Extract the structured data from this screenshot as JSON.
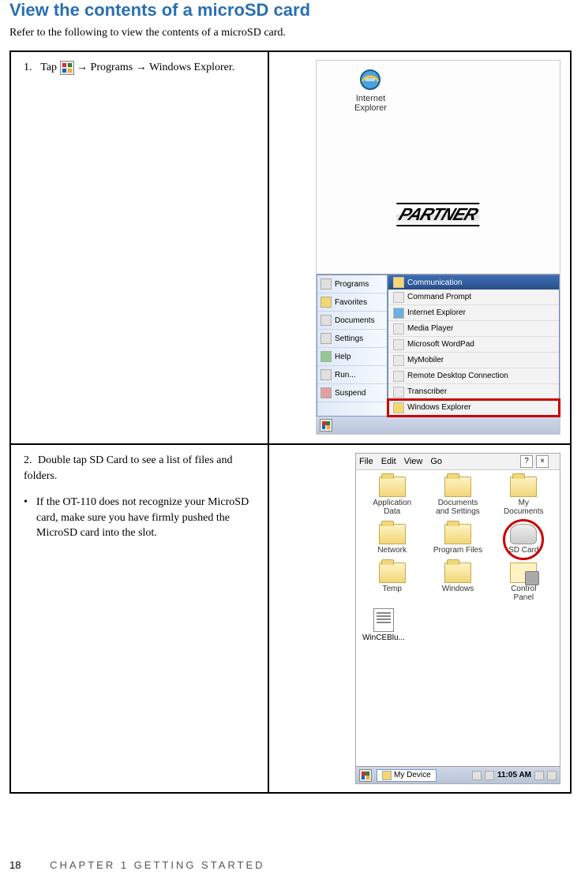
{
  "title": "View the contents of a microSD card",
  "intro": "Refer to the following to view the contents of a microSD card.",
  "step1": {
    "pre": "Tap",
    "post": " → Programs → Windows Explorer."
  },
  "step2": "Double tap SD Card to see a list of files and folders.",
  "note": "If the OT-110 does not recognize your MicroSD card, make sure you have firmly pushed the MicroSD card into the slot.",
  "shot1": {
    "ie_label": "Internet\nExplorer",
    "partner": "PARTNER",
    "startmenu": [
      "Programs",
      "Favorites",
      "Documents",
      "Settings",
      "Help",
      "Run...",
      "Suspend"
    ],
    "submenu_title": "Communication",
    "submenu": [
      "Command Prompt",
      "Internet Explorer",
      "Media Player",
      "Microsoft WordPad",
      "MyMobiler",
      "Remote Desktop Connection",
      "Transcriber",
      "Windows Explorer"
    ]
  },
  "shot2": {
    "menubar": [
      "File",
      "Edit",
      "View",
      "Go"
    ],
    "close_glyph": "×",
    "help_glyph": "?",
    "icons": [
      {
        "label": "Application\nData",
        "type": "folder"
      },
      {
        "label": "Documents\nand Settings",
        "type": "folder"
      },
      {
        "label": "My\nDocuments",
        "type": "folder"
      },
      {
        "label": "Network",
        "type": "folder"
      },
      {
        "label": "Program Files",
        "type": "folder"
      },
      {
        "label": "SD Card",
        "type": "sd",
        "highlight": true
      },
      {
        "label": "Temp",
        "type": "folder"
      },
      {
        "label": "Windows",
        "type": "folder"
      },
      {
        "label": "Control\nPanel",
        "type": "cp"
      }
    ],
    "extra_file": "WinCEBlu...",
    "taskbar_tab": "My Device",
    "clock": "11:05 AM"
  },
  "footer": {
    "page": "18",
    "chapter": "CHAPTER 1 GETTING STARTED"
  }
}
